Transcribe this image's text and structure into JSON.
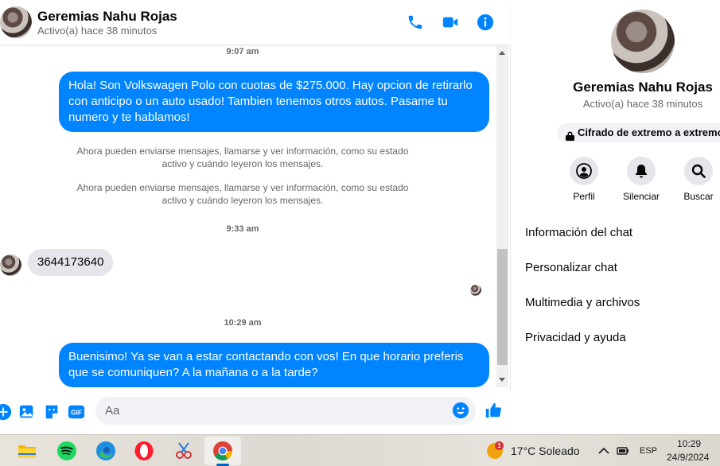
{
  "header": {
    "name": "Geremias Nahu Rojas",
    "status": "Activo(a) hace 38 minutos",
    "icons": [
      "phone-icon",
      "video-icon",
      "info-icon"
    ]
  },
  "messages": {
    "t1": "9:07 am",
    "m1": "Hola! Son Volkswagen Polo con cuotas de $275.000. Hay opcion de retirarlo con anticipo o un auto usado! Tambien tenemos otros autos. Pasame tu numero y te hablamos!",
    "sys1": "Ahora pueden enviarse mensajes, llamarse y ver información, como su estado activo y cuándo leyeron los mensajes.",
    "sys2": "Ahora pueden enviarse mensajes, llamarse y ver información, como su estado activo y cuándo leyeron los mensajes.",
    "t2": "9:33 am",
    "m2": "3644173640",
    "t3": "10:29 am",
    "m3": "Buenisimo! Ya se van a estar contactando con vos! En que horario preferis que se comuniquen? A la mañana o a la tarde?"
  },
  "composer": {
    "placeholder": "Aa",
    "icons": [
      "plus-circle-icon",
      "image-icon",
      "sticker-icon",
      "gif-icon",
      "emoji-icon",
      "thumbs-up-icon"
    ]
  },
  "info_panel": {
    "name": "Geremias Nahu Rojas",
    "status": "Activo(a) hace 38 minutos",
    "encryption": "Cifrado de extremo a extremo",
    "actions": [
      {
        "label": "Perfil",
        "icon": "profile-icon"
      },
      {
        "label": "Silenciar",
        "icon": "bell-icon"
      },
      {
        "label": "Buscar",
        "icon": "search-icon"
      }
    ],
    "menu": [
      "Información del chat",
      "Personalizar chat",
      "Multimedia y archivos",
      "Privacidad y ayuda"
    ]
  },
  "taskbar": {
    "apps": [
      "file-explorer-icon",
      "spotify-icon",
      "edge-icon",
      "opera-icon",
      "snipping-tool-icon",
      "chrome-icon"
    ],
    "weather_badge": "1",
    "weather": "17°C  Soleado",
    "language": "ESP",
    "time": "10:29",
    "date": "24/9/2024"
  },
  "colors": {
    "accent": "#0084ff",
    "incoming_bubble": "#e4e6eb",
    "secondary_text": "#65676b"
  }
}
